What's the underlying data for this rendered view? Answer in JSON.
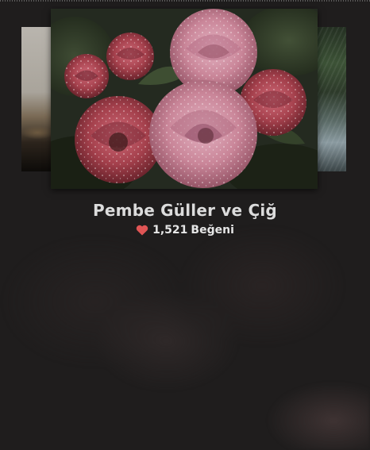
{
  "photo": {
    "title": "Pembe Güller ve Çiğ",
    "likes_count": "1,521",
    "likes_label": "Beğeni",
    "like_icon": "heart-icon",
    "like_icon_color": "#e05555"
  },
  "gallery": {
    "prev_thumb": "prev-photo-thumbnail",
    "next_thumb": "next-photo-thumbnail"
  },
  "colors": {
    "background": "#1f1d1d",
    "title_text": "#dcdcdc",
    "rose_pink": "#c98598",
    "rose_red": "#a4404c"
  }
}
